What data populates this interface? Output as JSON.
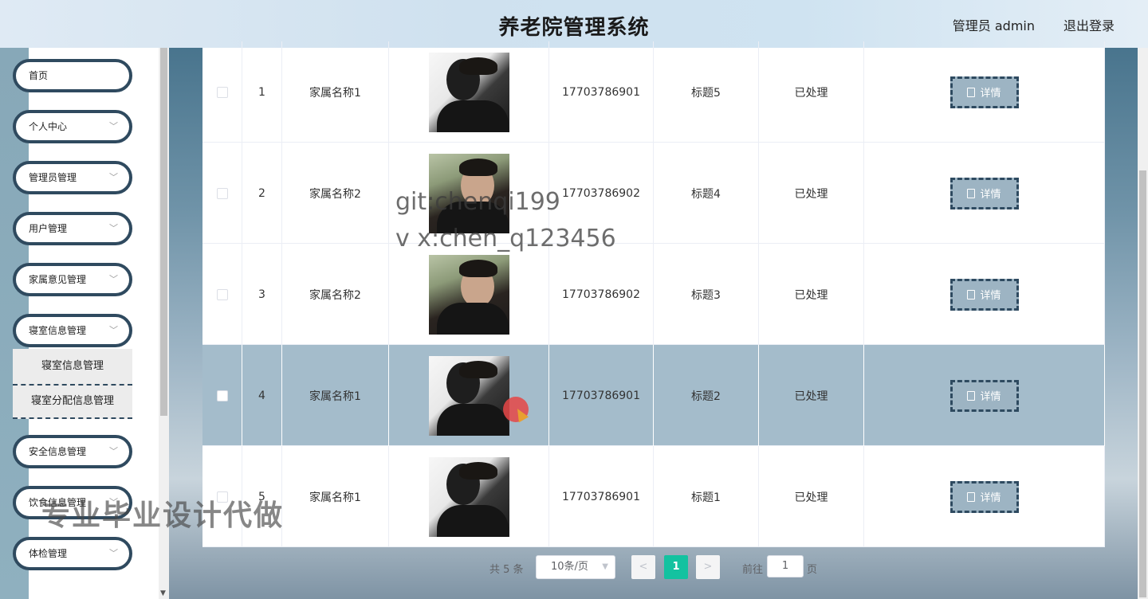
{
  "header": {
    "title": "养老院管理系统",
    "user_label": "管理员 admin",
    "logout_label": "退出登录"
  },
  "sidebar": {
    "items": [
      {
        "label": "首页",
        "has_children": false
      },
      {
        "label": "个人中心",
        "has_children": true
      },
      {
        "label": "管理员管理",
        "has_children": true
      },
      {
        "label": "用户管理",
        "has_children": true
      },
      {
        "label": "家属意见管理",
        "has_children": true
      },
      {
        "label": "寝室信息管理",
        "has_children": true
      },
      {
        "label": "安全信息管理",
        "has_children": true
      },
      {
        "label": "饮食信息管理",
        "has_children": true
      },
      {
        "label": "体检管理",
        "has_children": true
      }
    ],
    "submenu": [
      {
        "label": "寝室信息管理"
      },
      {
        "label": "寝室分配信息管理"
      }
    ],
    "chevron_icon": "chevron-down-icon"
  },
  "table": {
    "rows": [
      {
        "index": "1",
        "family_name": "家属名称1",
        "photo": "dark",
        "phone": "17703786901",
        "title": "标题5",
        "status": "已处理",
        "action": "详情",
        "highlight": false
      },
      {
        "index": "2",
        "family_name": "家属名称2",
        "photo": "light",
        "phone": "17703786902",
        "title": "标题4",
        "status": "已处理",
        "action": "详情",
        "highlight": false
      },
      {
        "index": "3",
        "family_name": "家属名称2",
        "photo": "light",
        "phone": "17703786902",
        "title": "标题3",
        "status": "已处理",
        "action": "详情",
        "highlight": false
      },
      {
        "index": "4",
        "family_name": "家属名称1",
        "photo": "dark",
        "phone": "17703786901",
        "title": "标题2",
        "status": "已处理",
        "action": "详情",
        "highlight": true
      },
      {
        "index": "5",
        "family_name": "家属名称1",
        "photo": "dark",
        "phone": "17703786901",
        "title": "标题1",
        "status": "已处理",
        "action": "详情",
        "highlight": false
      }
    ],
    "detail_icon": "document-icon"
  },
  "pagination": {
    "total": "共 5 条",
    "page_size": "10条/页",
    "prev": "<",
    "current": "1",
    "next": ">",
    "goto_prefix": "前往",
    "goto_value": "1",
    "goto_suffix": "页"
  },
  "watermarks": {
    "line1": "git:chenqi199",
    "line2": "v x:chen_q123456",
    "line3": "专业毕业设计代做"
  },
  "colors": {
    "accent": "#13c2a0",
    "highlight_row": "#a4bccb",
    "menu_border": "#2f4a5f",
    "detail_button": "#9db4c3"
  }
}
